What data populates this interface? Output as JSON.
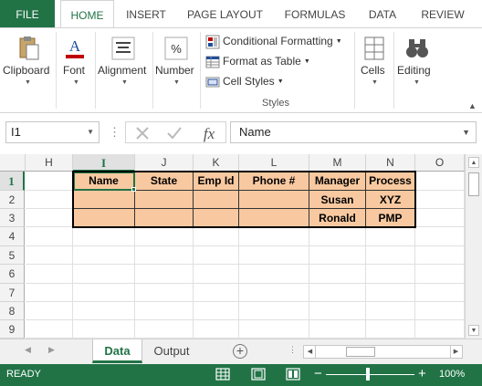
{
  "ribbon_tabs": [
    {
      "label": "FILE"
    },
    {
      "label": "HOME"
    },
    {
      "label": "INSERT"
    },
    {
      "label": "PAGE LAYOUT"
    },
    {
      "label": "FORMULAS"
    },
    {
      "label": "DATA"
    },
    {
      "label": "REVIEW"
    }
  ],
  "ribbon": {
    "clipboard": "Clipboard",
    "font": "Font",
    "alignment": "Alignment",
    "number": "Number",
    "number_symbol": "%",
    "font_symbol": "A",
    "conditional_formatting": "Conditional Formatting",
    "format_as_table": "Format as Table",
    "cell_styles": "Cell Styles",
    "styles_group": "Styles",
    "cells": "Cells",
    "editing": "Editing"
  },
  "formula_bar": {
    "name_box": "I1",
    "dots": "⋮",
    "formula": "Name"
  },
  "columns": [
    "H",
    "I",
    "J",
    "K",
    "L",
    "M",
    "N",
    "O"
  ],
  "rows": [
    "1",
    "2",
    "3",
    "4",
    "5",
    "6",
    "7",
    "8",
    "9"
  ],
  "table": {
    "headers": [
      "Name",
      "State",
      "Emp Id",
      "Phone #",
      "Manager",
      "Process"
    ],
    "row2": [
      "",
      "",
      "",
      "",
      "Susan",
      "XYZ"
    ],
    "row3": [
      "",
      "",
      "",
      "",
      "Ronald",
      "PMP"
    ]
  },
  "sheets": [
    "Data",
    "Output"
  ],
  "status": {
    "ready": "READY",
    "zoom": "100%"
  },
  "colors": {
    "accent": "#217346",
    "table_fill": "#f8c9a0"
  }
}
